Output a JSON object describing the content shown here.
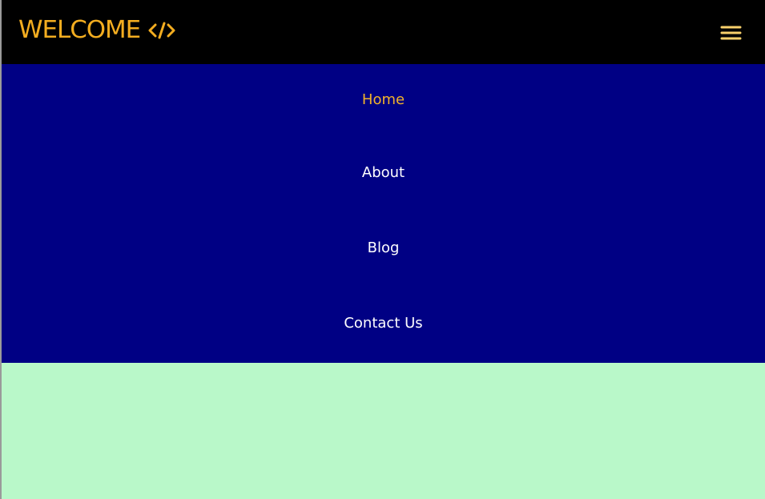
{
  "header": {
    "brand_text": "WELCOME",
    "brand_icon": "code-icon",
    "menu_icon": "hamburger-menu-icon"
  },
  "navigation": {
    "items": [
      {
        "label": "Home",
        "state": "active"
      },
      {
        "label": "About",
        "state": "default"
      },
      {
        "label": "Blog",
        "state": "default"
      },
      {
        "label": "Contact Us",
        "state": "default"
      }
    ]
  },
  "colors": {
    "header_background": "#000000",
    "brand_accent": "#f3ad20",
    "navigation_background": "#000084",
    "navigation_text": "#ffffff",
    "active_navigation_text": "#f1b22b",
    "content_background": "#b9f8c9"
  }
}
